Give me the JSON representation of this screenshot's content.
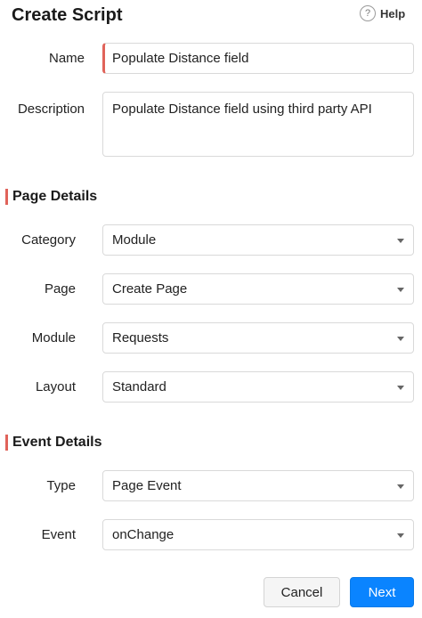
{
  "header": {
    "title": "Create Script",
    "help_icon": "question-circle-icon",
    "help_label": "Help"
  },
  "basic": {
    "name_label": "Name",
    "name_value": "Populate Distance field",
    "description_label": "Description",
    "description_value": "Populate Distance field using third party API"
  },
  "page_details": {
    "heading": "Page Details",
    "category_label": "Category",
    "category_value": "Module",
    "page_label": "Page",
    "page_value": "Create Page",
    "module_label": "Module",
    "module_value": "Requests",
    "layout_label": "Layout",
    "layout_value": "Standard"
  },
  "event_details": {
    "heading": "Event Details",
    "type_label": "Type",
    "type_value": "Page Event",
    "event_label": "Event",
    "event_value": "onChange"
  },
  "buttons": {
    "cancel": "Cancel",
    "next": "Next"
  },
  "colors": {
    "accent": "#e0635a",
    "primary": "#0a84ff"
  }
}
